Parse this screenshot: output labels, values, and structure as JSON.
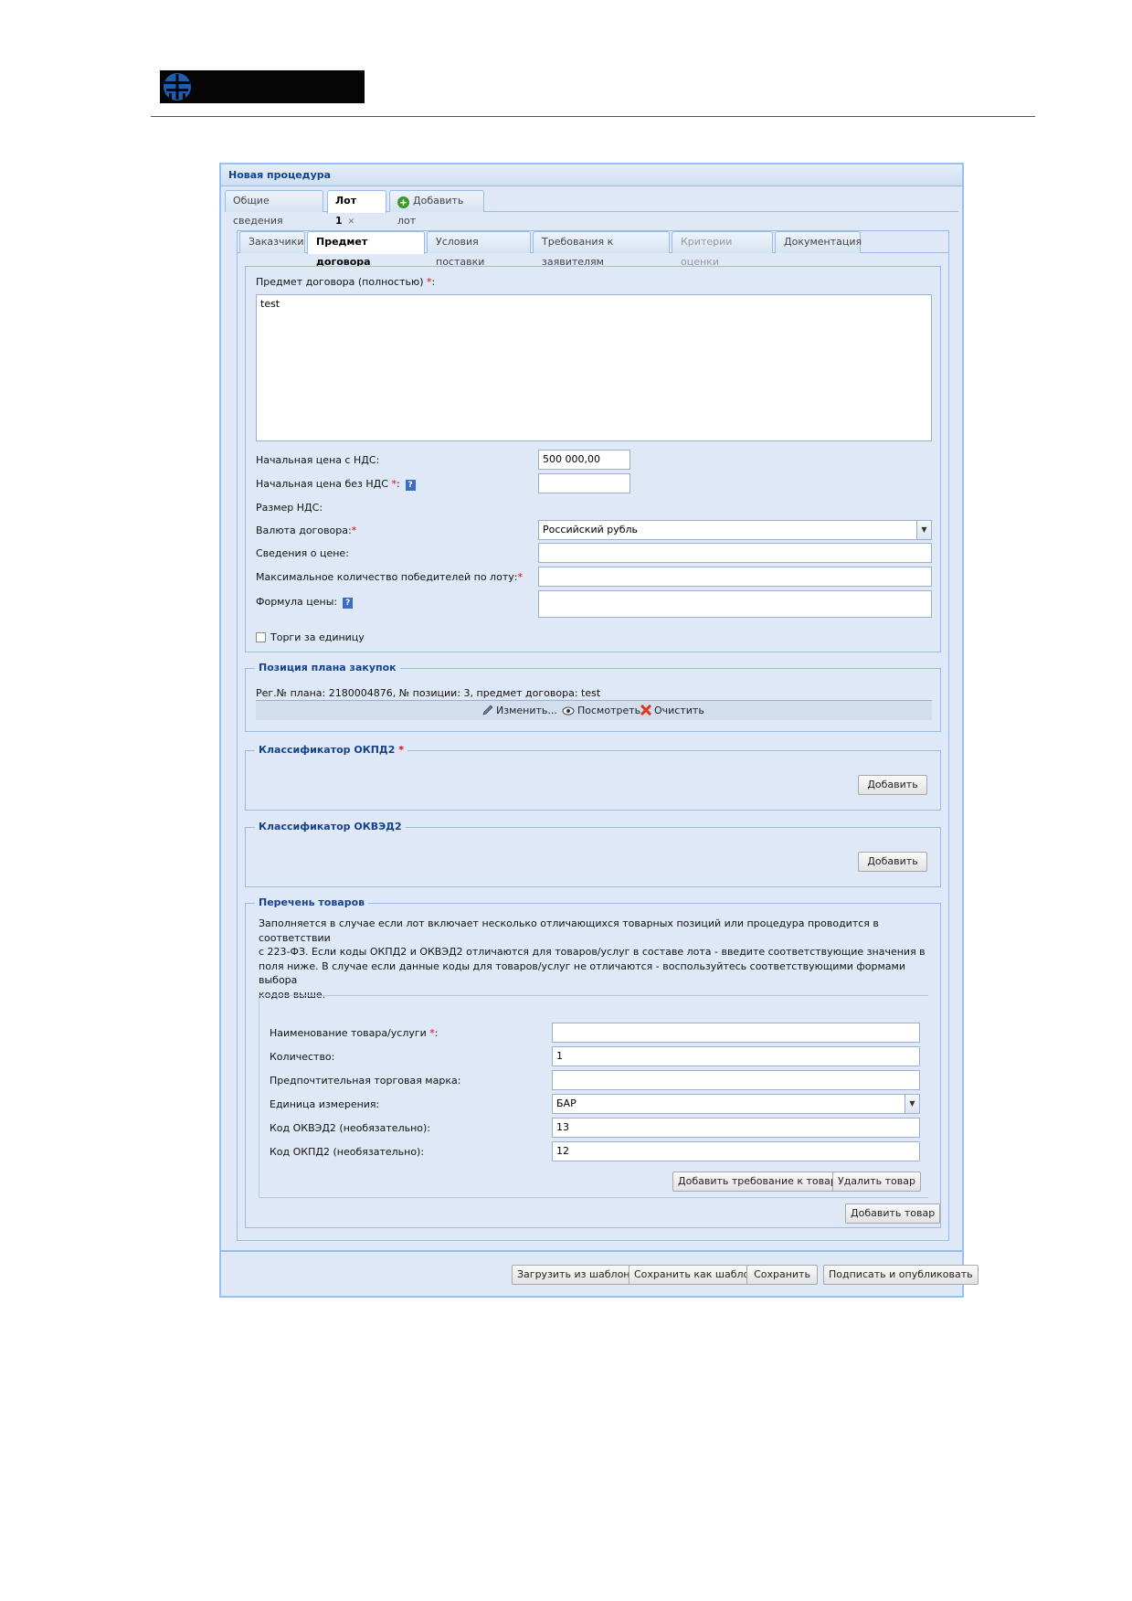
{
  "window": {
    "title": "Новая процедура"
  },
  "top_tabs": [
    "Общие сведения",
    "Лот 1",
    "Добавить лот"
  ],
  "sub_tabs": [
    "Заказчики",
    "Предмет договора",
    "Условия поставки",
    "Требования к заявителям",
    "Критерии оценки",
    "Документация"
  ],
  "subject": {
    "label": "Предмет договора (полностью)",
    "value": "test"
  },
  "price": {
    "with_vat_label": "Начальная цена с НДС:",
    "with_vat_value": "500 000,00",
    "without_vat_label": "Начальная цена без НДС",
    "without_vat_value": "",
    "vat_size_label": "Размер НДС:",
    "currency_label": "Валюта договора:",
    "currency_value": "Российский рубль",
    "info_label": "Сведения о цене:",
    "info_value": "",
    "max_winners_label": "Максимальное количество победителей по лоту:",
    "max_winners_value": "",
    "formula_label": "Формула цены:",
    "formula_value": "",
    "per_unit_label": "Торги за единицу"
  },
  "plan": {
    "legend": "Позиция плана закупок",
    "text": "Рег.№ плана: 2180004876, № позиции: 3, предмет договора: test",
    "edit": "Изменить...",
    "view": "Посмотреть",
    "clear": "Очистить"
  },
  "okpd2": {
    "legend": "Классификатор ОКПД2",
    "add": "Добавить"
  },
  "okved2": {
    "legend": "Классификатор ОКВЭД2",
    "add": "Добавить"
  },
  "goods": {
    "legend": "Перечень товаров",
    "description_lines": [
      "Заполняется в случае если лот включает несколько отличающихся товарных позиций или процедура проводится в соответствии",
      "с 223-ФЗ. Если коды ОКПД2 и ОКВЭД2 отличаются для товаров/услуг в составе лота - введите соответствующие значения в",
      "поля ниже. В случае если данные коды для товаров/услуг не отличаются - воспользуйтесь соответствующими формами выбора",
      "кодов выше."
    ],
    "name_label": "Наименование товара/услуги",
    "name_value": "",
    "qty_label": "Количество:",
    "qty_value": "1",
    "brand_label": "Предпочтительная торговая марка:",
    "brand_value": "",
    "unit_label": "Единица измерения:",
    "unit_value": "БАР",
    "okved_label": "Код ОКВЭД2 (необязательно):",
    "okved_value": "13",
    "okpd_label": "Код ОКПД2 (необязательно):",
    "okpd_value": "12",
    "add_requirement": "Добавить требование к товару",
    "delete_item": "Удалить товар",
    "add_item": "Добавить товар"
  },
  "footer": {
    "load_template": "Загрузить из шаблона",
    "save_template": "Сохранить как шаблон",
    "save": "Сохранить",
    "sign_publish": "Подписать и опубликовать"
  },
  "required_mark": "*",
  "close_mark": "✕",
  "colors": {
    "header_text": "#15428b",
    "frame": "#99bbe8",
    "background": "#dfe8f6",
    "required": "#e00000"
  }
}
